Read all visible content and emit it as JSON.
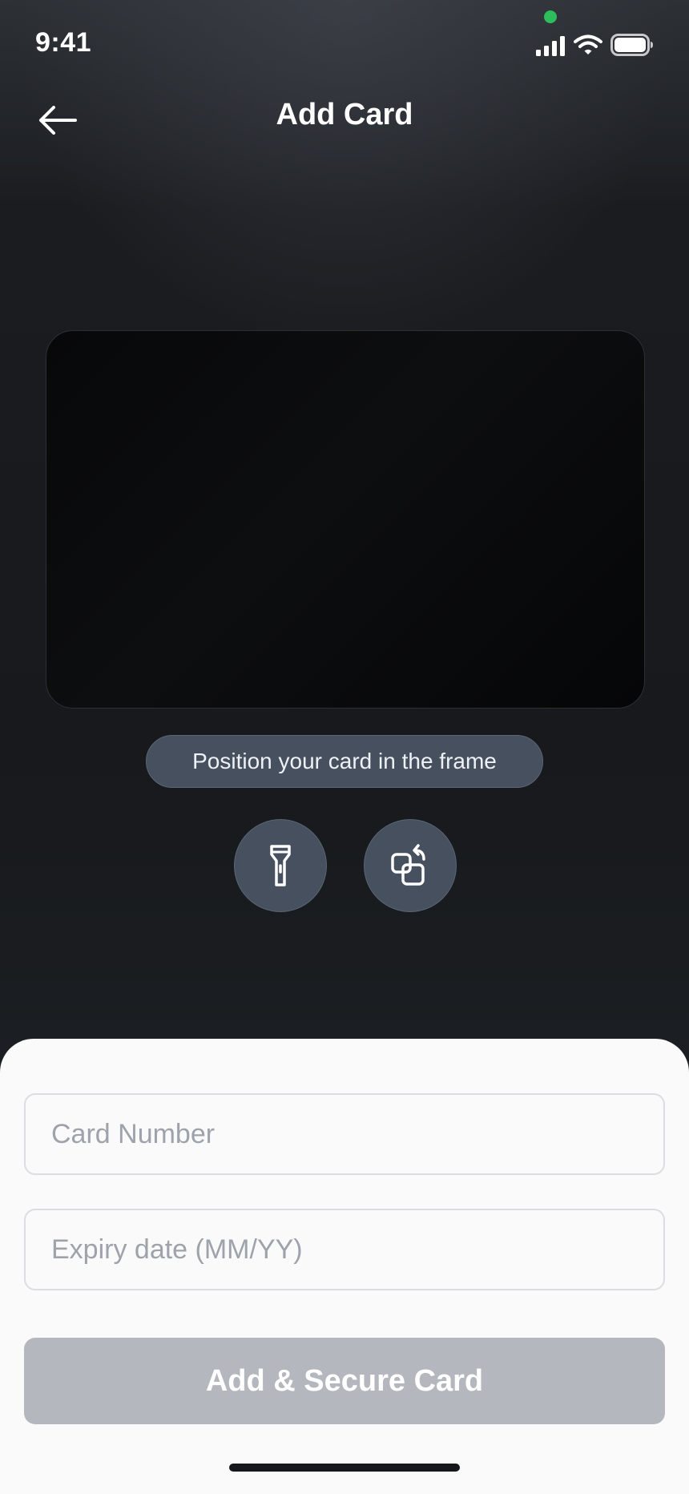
{
  "status_bar": {
    "time": "9:41",
    "privacy_dot_color": "#2dbd5a",
    "icons": [
      "cellular-signal-icon",
      "wifi-icon",
      "battery-icon"
    ]
  },
  "header": {
    "back_icon": "arrow-left-icon",
    "title": "Add Card"
  },
  "scanner": {
    "hint": "Position your card in the frame",
    "controls": [
      {
        "name": "flashlight",
        "icon": "flashlight-icon"
      },
      {
        "name": "flip-camera",
        "icon": "switch-camera-icon"
      }
    ]
  },
  "form": {
    "card_number": {
      "placeholder": "Card Number",
      "value": ""
    },
    "expiry": {
      "placeholder": "Expiry date (MM/YY)",
      "value": ""
    },
    "submit_label": "Add & Secure Card"
  },
  "colors": {
    "background": "#17191c",
    "pill": "#46505f",
    "sheet": "#fafafa",
    "submit_disabled": "#b4b7bd",
    "privacy_dot": "#2dbd5a"
  }
}
